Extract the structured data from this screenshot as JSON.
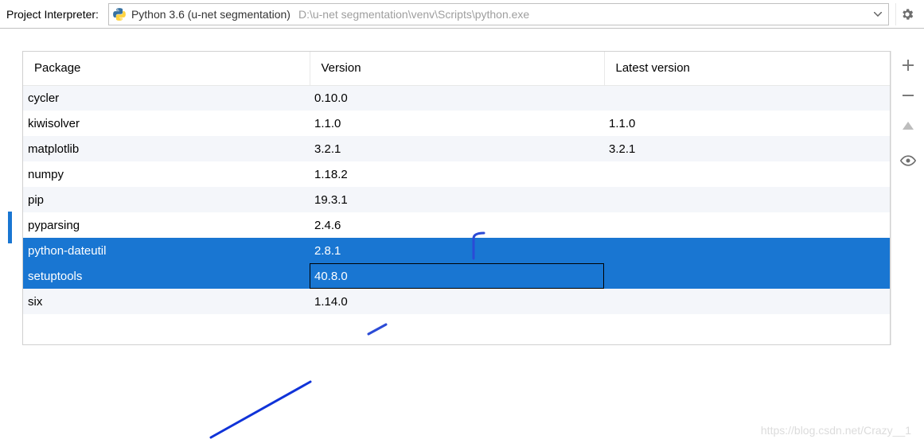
{
  "header": {
    "label": "Project Interpreter:",
    "interpreter_name": "Python 3.6 (u-net segmentation)",
    "interpreter_path": "D:\\u-net segmentation\\venv\\Scripts\\python.exe"
  },
  "table": {
    "columns": {
      "package": "Package",
      "version": "Version",
      "latest": "Latest version"
    },
    "rows": [
      {
        "package": "cycler",
        "version": "0.10.0",
        "latest": "",
        "selected": false
      },
      {
        "package": "kiwisolver",
        "version": "1.1.0",
        "latest": "1.1.0",
        "selected": false
      },
      {
        "package": "matplotlib",
        "version": "3.2.1",
        "latest": "3.2.1",
        "selected": false
      },
      {
        "package": "numpy",
        "version": "1.18.2",
        "latest": "",
        "selected": false
      },
      {
        "package": "pip",
        "version": "19.3.1",
        "latest": "",
        "selected": false
      },
      {
        "package": "pyparsing",
        "version": "2.4.6",
        "latest": "",
        "selected": false
      },
      {
        "package": "python-dateutil",
        "version": "2.8.1",
        "latest": "",
        "selected": true
      },
      {
        "package": "setuptools",
        "version": "40.8.0",
        "latest": "",
        "selected": true,
        "focus_version": true
      },
      {
        "package": "six",
        "version": "1.14.0",
        "latest": "",
        "selected": false
      }
    ]
  },
  "watermark": "https://blog.csdn.net/Crazy__1"
}
